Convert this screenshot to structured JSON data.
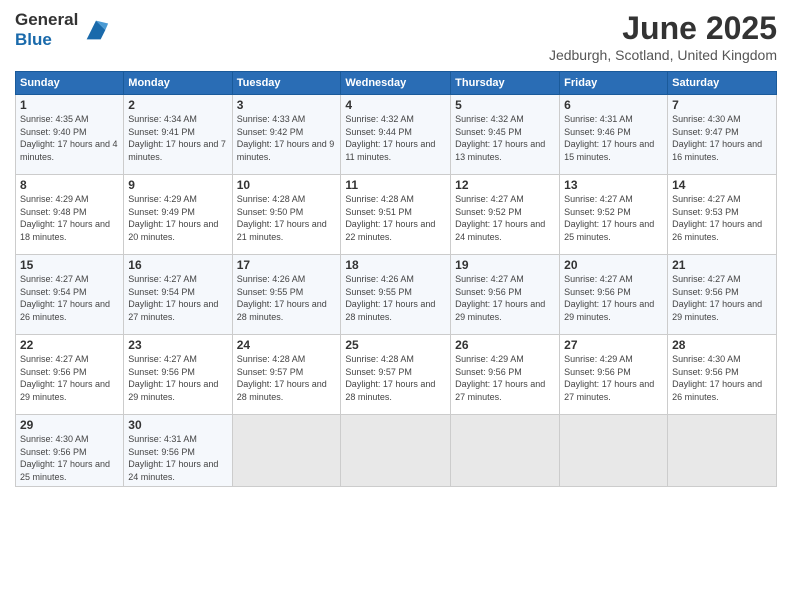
{
  "header": {
    "logo_general": "General",
    "logo_blue": "Blue",
    "month_year": "June 2025",
    "location": "Jedburgh, Scotland, United Kingdom"
  },
  "days_of_week": [
    "Sunday",
    "Monday",
    "Tuesday",
    "Wednesday",
    "Thursday",
    "Friday",
    "Saturday"
  ],
  "weeks": [
    [
      {
        "day": "1",
        "sunrise": "4:35 AM",
        "sunset": "9:40 PM",
        "daylight": "17 hours and 4 minutes."
      },
      {
        "day": "2",
        "sunrise": "4:34 AM",
        "sunset": "9:41 PM",
        "daylight": "17 hours and 7 minutes."
      },
      {
        "day": "3",
        "sunrise": "4:33 AM",
        "sunset": "9:42 PM",
        "daylight": "17 hours and 9 minutes."
      },
      {
        "day": "4",
        "sunrise": "4:32 AM",
        "sunset": "9:44 PM",
        "daylight": "17 hours and 11 minutes."
      },
      {
        "day": "5",
        "sunrise": "4:32 AM",
        "sunset": "9:45 PM",
        "daylight": "17 hours and 13 minutes."
      },
      {
        "day": "6",
        "sunrise": "4:31 AM",
        "sunset": "9:46 PM",
        "daylight": "17 hours and 15 minutes."
      },
      {
        "day": "7",
        "sunrise": "4:30 AM",
        "sunset": "9:47 PM",
        "daylight": "17 hours and 16 minutes."
      }
    ],
    [
      {
        "day": "8",
        "sunrise": "4:29 AM",
        "sunset": "9:48 PM",
        "daylight": "17 hours and 18 minutes."
      },
      {
        "day": "9",
        "sunrise": "4:29 AM",
        "sunset": "9:49 PM",
        "daylight": "17 hours and 20 minutes."
      },
      {
        "day": "10",
        "sunrise": "4:28 AM",
        "sunset": "9:50 PM",
        "daylight": "17 hours and 21 minutes."
      },
      {
        "day": "11",
        "sunrise": "4:28 AM",
        "sunset": "9:51 PM",
        "daylight": "17 hours and 22 minutes."
      },
      {
        "day": "12",
        "sunrise": "4:27 AM",
        "sunset": "9:52 PM",
        "daylight": "17 hours and 24 minutes."
      },
      {
        "day": "13",
        "sunrise": "4:27 AM",
        "sunset": "9:52 PM",
        "daylight": "17 hours and 25 minutes."
      },
      {
        "day": "14",
        "sunrise": "4:27 AM",
        "sunset": "9:53 PM",
        "daylight": "17 hours and 26 minutes."
      }
    ],
    [
      {
        "day": "15",
        "sunrise": "4:27 AM",
        "sunset": "9:54 PM",
        "daylight": "17 hours and 26 minutes."
      },
      {
        "day": "16",
        "sunrise": "4:27 AM",
        "sunset": "9:54 PM",
        "daylight": "17 hours and 27 minutes."
      },
      {
        "day": "17",
        "sunrise": "4:26 AM",
        "sunset": "9:55 PM",
        "daylight": "17 hours and 28 minutes."
      },
      {
        "day": "18",
        "sunrise": "4:26 AM",
        "sunset": "9:55 PM",
        "daylight": "17 hours and 28 minutes."
      },
      {
        "day": "19",
        "sunrise": "4:27 AM",
        "sunset": "9:56 PM",
        "daylight": "17 hours and 29 minutes."
      },
      {
        "day": "20",
        "sunrise": "4:27 AM",
        "sunset": "9:56 PM",
        "daylight": "17 hours and 29 minutes."
      },
      {
        "day": "21",
        "sunrise": "4:27 AM",
        "sunset": "9:56 PM",
        "daylight": "17 hours and 29 minutes."
      }
    ],
    [
      {
        "day": "22",
        "sunrise": "4:27 AM",
        "sunset": "9:56 PM",
        "daylight": "17 hours and 29 minutes."
      },
      {
        "day": "23",
        "sunrise": "4:27 AM",
        "sunset": "9:56 PM",
        "daylight": "17 hours and 29 minutes."
      },
      {
        "day": "24",
        "sunrise": "4:28 AM",
        "sunset": "9:57 PM",
        "daylight": "17 hours and 28 minutes."
      },
      {
        "day": "25",
        "sunrise": "4:28 AM",
        "sunset": "9:57 PM",
        "daylight": "17 hours and 28 minutes."
      },
      {
        "day": "26",
        "sunrise": "4:29 AM",
        "sunset": "9:56 PM",
        "daylight": "17 hours and 27 minutes."
      },
      {
        "day": "27",
        "sunrise": "4:29 AM",
        "sunset": "9:56 PM",
        "daylight": "17 hours and 27 minutes."
      },
      {
        "day": "28",
        "sunrise": "4:30 AM",
        "sunset": "9:56 PM",
        "daylight": "17 hours and 26 minutes."
      }
    ],
    [
      {
        "day": "29",
        "sunrise": "4:30 AM",
        "sunset": "9:56 PM",
        "daylight": "17 hours and 25 minutes."
      },
      {
        "day": "30",
        "sunrise": "4:31 AM",
        "sunset": "9:56 PM",
        "daylight": "17 hours and 24 minutes."
      },
      null,
      null,
      null,
      null,
      null
    ]
  ]
}
